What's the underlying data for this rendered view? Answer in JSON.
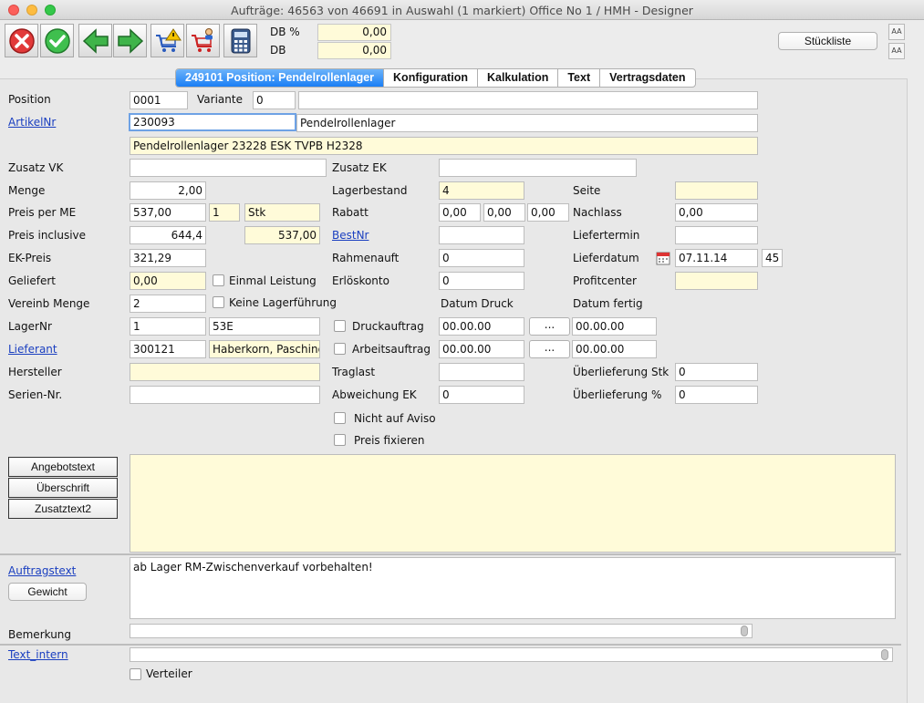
{
  "window": {
    "title": "Aufträge: 46563 von 46691 in Auswahl  (1 markiert) Office No 1 /  HMH - Designer"
  },
  "toolbar": {
    "db_pct_label": "DB %",
    "db_pct_value": "0,00",
    "db_label": "DB",
    "db_value": "0,00",
    "stueckliste": "Stückliste",
    "font_up": "AA",
    "font_down": "AA"
  },
  "tabs": [
    {
      "label": "249101 Position: Pendelrollenlager",
      "active": true
    },
    {
      "label": "Konfiguration",
      "active": false
    },
    {
      "label": "Kalkulation",
      "active": false
    },
    {
      "label": "Text",
      "active": false
    },
    {
      "label": "Vertragsdaten",
      "active": false
    }
  ],
  "form": {
    "position_label": "Position",
    "position_value": "0001",
    "variante_label": "Variante",
    "variante_value": "0",
    "variante_extra": "",
    "artikelnr_label": "ArtikelNr",
    "artikelnr_value": "230093",
    "artikel_name": "Pendelrollenlager",
    "artikel_desc": "Pendelrollenlager 23228 ESK TVPB H2328",
    "zusatz_vk_label": "Zusatz VK",
    "zusatz_vk_value": "",
    "zusatz_ek_label": "Zusatz EK",
    "zusatz_ek_value": "",
    "menge_label": "Menge",
    "menge_value": "2,00",
    "lagerbestand_label": "Lagerbestand",
    "lagerbestand_value": "4",
    "seite_label": "Seite",
    "seite_value": "",
    "preis_me_label": "Preis per ME",
    "preis_me_value": "537,00",
    "preis_me_qty": "1",
    "preis_me_unit": "Stk",
    "rabatt_label": "Rabatt",
    "rabatt_1": "0,00",
    "rabatt_2": "0,00",
    "rabatt_3": "0,00",
    "nachlass_label": "Nachlass",
    "nachlass_value": "0,00",
    "preis_incl_label": "Preis inclusive",
    "preis_incl_value": "644,4",
    "preis_incl_net": "537,00",
    "bestnr_label": "BestNr",
    "bestnr_value": "",
    "liefertermin_label": "Liefertermin",
    "liefertermin_value": "",
    "ek_preis_label": "EK-Preis",
    "ek_preis_value": "321,29",
    "rahmenauft_label": "Rahmenauft",
    "rahmenauft_value": "0",
    "lieferdatum_label": "Lieferdatum",
    "lieferdatum_value": "07.11.14",
    "lieferdatum_week": "45",
    "geliefert_label": "Geliefert",
    "geliefert_value": "0,00",
    "einmal_leistung_label": "Einmal Leistung",
    "erloeskonto_label": "Erlöskonto",
    "erloeskonto_value": "0",
    "profitcenter_label": "Profitcenter",
    "profitcenter_value": "",
    "vereinb_menge_label": "Vereinb Menge",
    "vereinb_menge_value": "2",
    "keine_lager_label": "Keine Lagerführung",
    "datum_druck_label": "Datum Druck",
    "datum_fertig_label": "Datum fertig",
    "lagernr_label": "LagerNr",
    "lagernr_value": "1",
    "lagernr_name": "53E",
    "druckauftrag_label": "Druckauftrag",
    "druck_datum": "00.00.00",
    "druck_fertig": "00.00.00",
    "dots": "...",
    "lieferant_label": "Lieferant",
    "lieferant_value": "300121",
    "lieferant_name": "Haberkorn, Pasching",
    "arbeitsauftrag_label": "Arbeitsauftrag",
    "arbeit_datum": "00.00.00",
    "arbeit_fertig": "00.00.00",
    "hersteller_label": "Hersteller",
    "hersteller_value": "",
    "traglast_label": "Traglast",
    "traglast_value": "",
    "ueberlieferung_stk_label": "Überlieferung Stk",
    "ueberlieferung_stk_value": "0",
    "seriennr_label": "Serien-Nr.",
    "seriennr_value": "",
    "abweichung_ek_label": "Abweichung EK",
    "abweichung_ek_value": "0",
    "ueberlieferung_pct_label": "Überlieferung %",
    "ueberlieferung_pct_value": "0",
    "nicht_aviso_label": "Nicht auf Aviso",
    "preis_fixieren_label": "Preis fixieren"
  },
  "texts": {
    "angebotstext_btn": "Angebotstext",
    "ueberschrift_btn": "Überschrift",
    "zusatztext2_btn": "Zusatztext2",
    "angebot_content": "",
    "auftragstext_label": "Auftragstext",
    "gewicht_btn": "Gewicht",
    "auftrag_content": "ab Lager RM-Zwischenverkauf vorbehalten!",
    "bemerkung_label": "Bemerkung",
    "bemerkung_value": "",
    "text_intern_label": "Text_intern",
    "text_intern_value": "",
    "verteiler_label": "Verteiler"
  }
}
